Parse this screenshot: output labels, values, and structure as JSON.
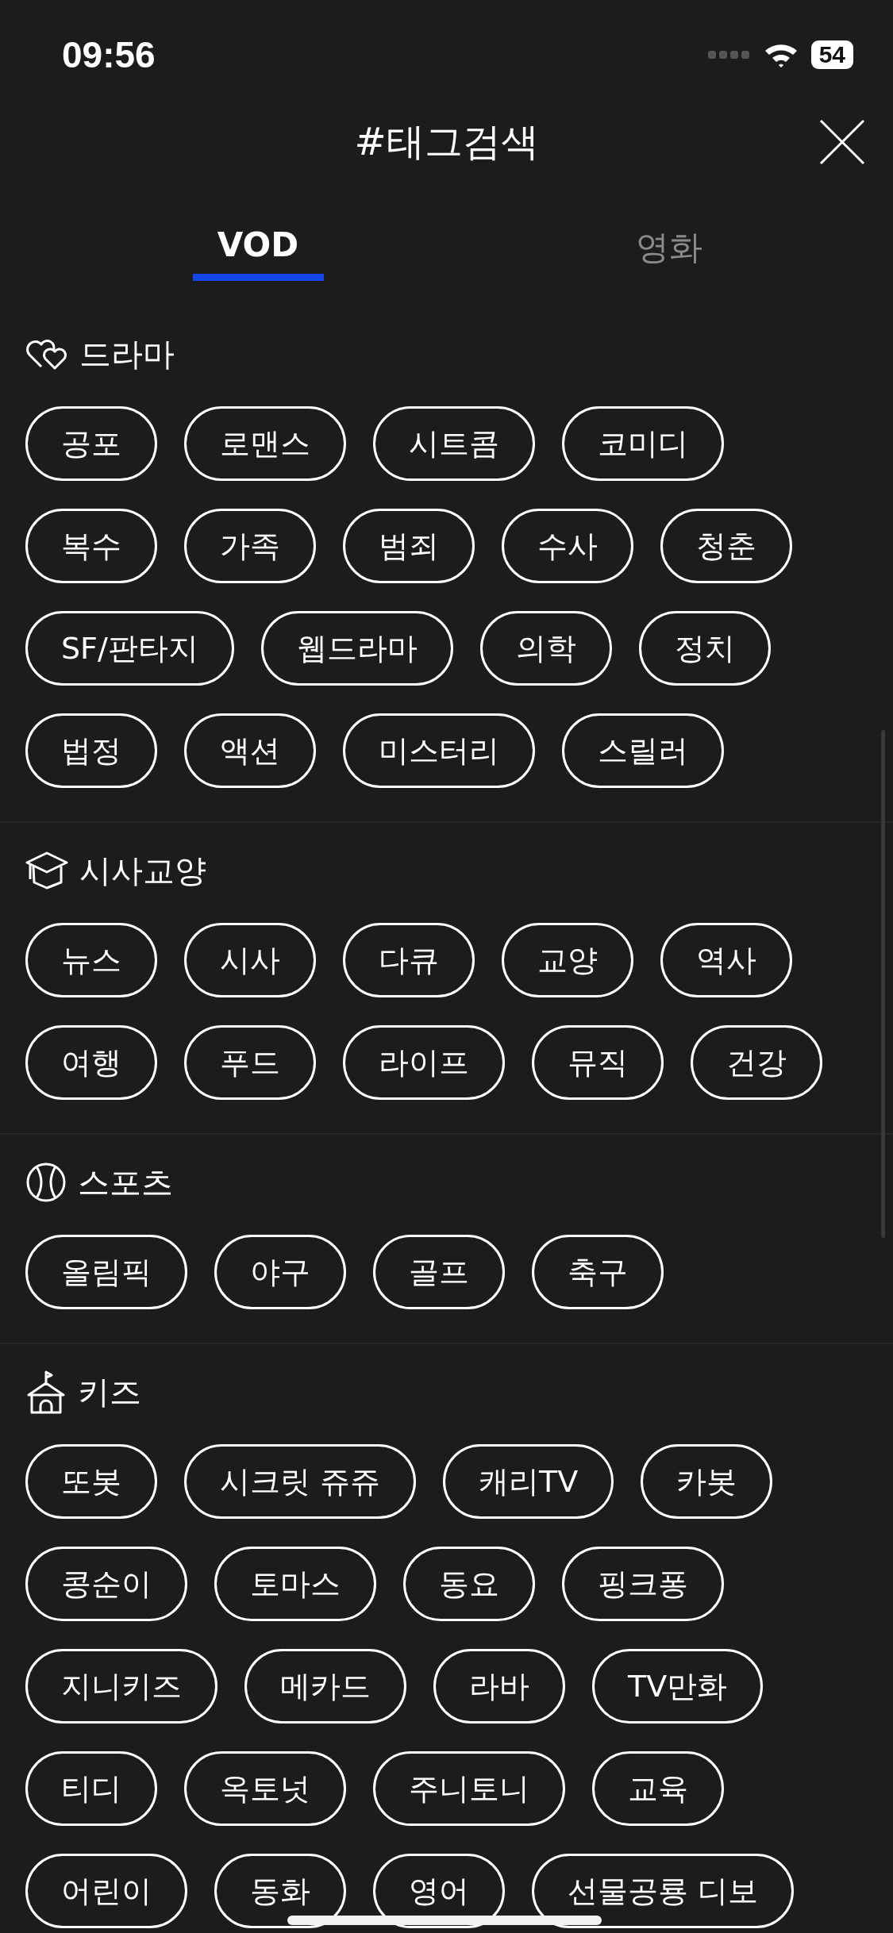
{
  "status_bar": {
    "time": "09:56",
    "battery": "54"
  },
  "header": {
    "title": "#태그검색"
  },
  "tabs": [
    {
      "label": "VOD",
      "selected": true
    },
    {
      "label": "영화",
      "selected": false
    }
  ],
  "sections": [
    {
      "title": "드라마",
      "kind": "hearts",
      "tags": [
        "공포",
        "로맨스",
        "시트콤",
        "코미디",
        "복수",
        "가족",
        "범죄",
        "수사",
        "청춘",
        "SF/판타지",
        "웹드라마",
        "의학",
        "정치",
        "법정",
        "액션",
        "미스터리",
        "스릴러"
      ]
    },
    {
      "title": "시사교양",
      "kind": "cap",
      "tags": [
        "뉴스",
        "시사",
        "다큐",
        "교양",
        "역사",
        "여행",
        "푸드",
        "라이프",
        "뮤직",
        "건강"
      ]
    },
    {
      "title": "스포츠",
      "kind": "ball",
      "tags": [
        "올림픽",
        "야구",
        "골프",
        "축구"
      ]
    },
    {
      "title": "키즈",
      "kind": "house",
      "tags": [
        "또봇",
        "시크릿 쥬쥬",
        "캐리TV",
        "카봇",
        "콩순이",
        "토마스",
        "동요",
        "핑크퐁",
        "지니키즈",
        "메카드",
        "라바",
        "TV만화",
        "티디",
        "옥토넛",
        "주니토니",
        "교육",
        "어린이",
        "동화",
        "영어",
        "선물공룡 디보"
      ]
    }
  ]
}
